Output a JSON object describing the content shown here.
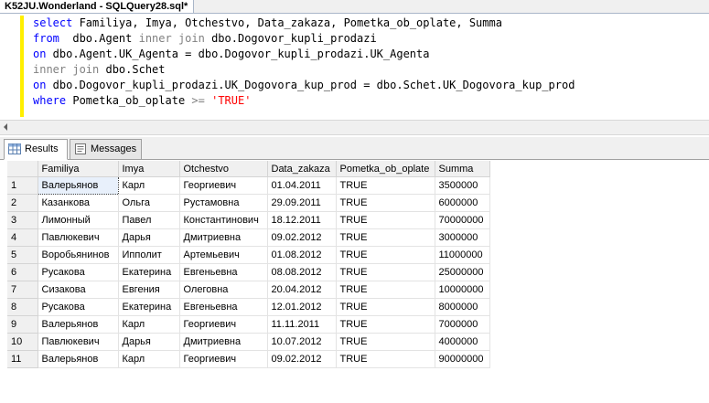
{
  "window": {
    "tab_title": "K52JU.Wonderland - SQLQuery28.sql*"
  },
  "editor": {
    "lines": [
      [
        {
          "t": "select",
          "c": "kw"
        },
        {
          "t": " Familiya, Imya, Otchestvo, Data_zakaza, Pometka_ob_oplate, Summa",
          "c": ""
        }
      ],
      [
        {
          "t": "from",
          "c": "kw"
        },
        {
          "t": "  dbo.Agent ",
          "c": ""
        },
        {
          "t": "inner join",
          "c": "gr"
        },
        {
          "t": " dbo.Dogovor_kupli_prodazi",
          "c": ""
        }
      ],
      [
        {
          "t": "on",
          "c": "kw"
        },
        {
          "t": " dbo.Agent.UK_Agenta = dbo.Dogovor_kupli_prodazi.UK_Agenta",
          "c": ""
        }
      ],
      [
        {
          "t": "inner join",
          "c": "gr"
        },
        {
          "t": " dbo.Schet",
          "c": ""
        }
      ],
      [
        {
          "t": "on",
          "c": "kw"
        },
        {
          "t": " dbo.Dogovor_kupli_prodazi.UK_Dogovora_kup_prod = dbo.Schet.UK_Dogovora_kup_prod",
          "c": ""
        }
      ],
      [
        {
          "t": "where",
          "c": "kw"
        },
        {
          "t": " Pometka_ob_oplate ",
          "c": ""
        },
        {
          "t": ">=",
          "c": "gr"
        },
        {
          "t": " ",
          "c": ""
        },
        {
          "t": "'TRUE'",
          "c": "str"
        }
      ]
    ]
  },
  "results_tabs": {
    "results_label": "Results",
    "messages_label": "Messages"
  },
  "results": {
    "columns": [
      "Familiya",
      "Imya",
      "Otchestvo",
      "Data_zakaza",
      "Pometka_ob_oplate",
      "Summa"
    ],
    "rows": [
      [
        "1",
        "Валерьянов",
        "Карл",
        "Георгиевич",
        "01.04.2011",
        "TRUE",
        "3500000"
      ],
      [
        "2",
        "Казанкова",
        "Ольга",
        "Рустамовна",
        "29.09.2011",
        "TRUE",
        "6000000"
      ],
      [
        "3",
        "Лимонный",
        "Павел",
        "Константинович",
        "18.12.2011",
        "TRUE",
        "70000000"
      ],
      [
        "4",
        "Павлюкевич",
        "Дарья",
        "Дмитриевна",
        "09.02.2012",
        "TRUE",
        "3000000"
      ],
      [
        "5",
        "Воробьянинов",
        "Ипполит",
        "Артемьевич",
        "01.08.2012",
        "TRUE",
        "11000000"
      ],
      [
        "6",
        "Русакова",
        "Екатерина",
        "Евгеньевна",
        "08.08.2012",
        "TRUE",
        "25000000"
      ],
      [
        "7",
        "Сизакова",
        "Евгения",
        "Олеговна",
        "20.04.2012",
        "TRUE",
        "10000000"
      ],
      [
        "8",
        "Русакова",
        "Екатерина",
        "Евгеньевна",
        "12.01.2012",
        "TRUE",
        "8000000"
      ],
      [
        "9",
        "Валерьянов",
        "Карл",
        "Георгиевич",
        "11.11.2011",
        "TRUE",
        "7000000"
      ],
      [
        "10",
        "Павлюкевич",
        "Дарья",
        "Дмитриевна",
        "10.07.2012",
        "TRUE",
        "4000000"
      ],
      [
        "11",
        "Валерьянов",
        "Карл",
        "Георгиевич",
        "09.02.2012",
        "TRUE",
        "90000000"
      ]
    ]
  },
  "colors": {
    "keyword": "#0000ff",
    "operator": "#808080",
    "string": "#ff0000",
    "change_bar": "#ffef00"
  }
}
